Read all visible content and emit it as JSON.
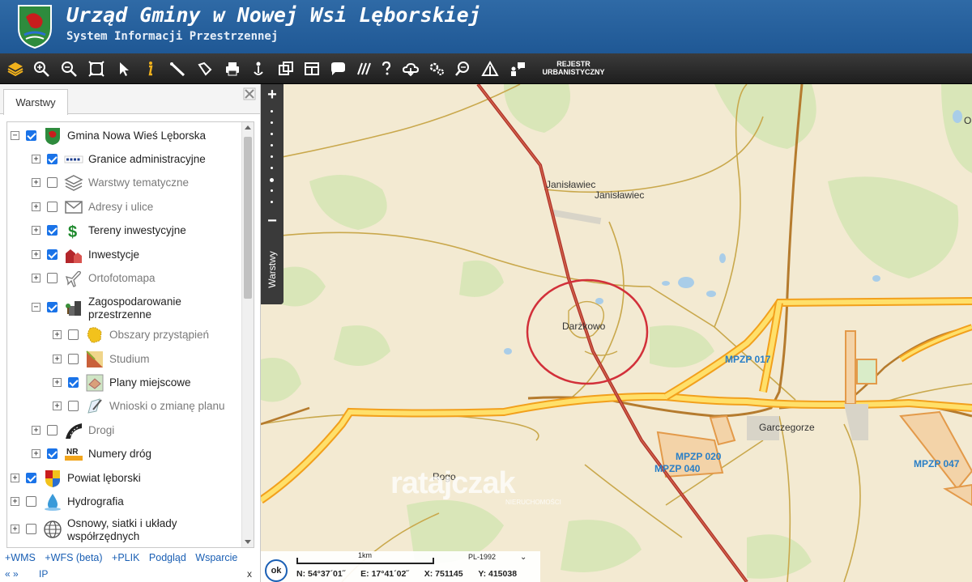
{
  "header": {
    "title": "Urząd Gminy w Nowej Wsi Lęborskiej",
    "subtitle": "System Informacji Przestrzennej"
  },
  "toolbar": {
    "buttons": [
      "layers-icon",
      "zoom-in-icon",
      "zoom-out-icon",
      "zoom-extent-icon",
      "select-icon",
      "info-icon",
      "measure-distance-icon",
      "measure-area-icon",
      "print-icon",
      "location-icon",
      "copy-icon",
      "layout-icon",
      "comment-icon",
      "hatch-icon",
      "help-icon",
      "cloud-icon",
      "settings-icon",
      "search-icon",
      "warning-icon",
      "user-chat-icon"
    ],
    "rejestr_line1": "REJESTR",
    "rejestr_line2": "URBANISTYCZNY"
  },
  "panel": {
    "tab_label": "Warstwy",
    "tree": [
      {
        "label": "Gmina Nowa Wieś Lęborska",
        "checked": true,
        "icon": "crest-icon"
      },
      {
        "label": "Granice administracyjne",
        "checked": true,
        "icon": "boundary-icon"
      },
      {
        "label": "Warstwy tematyczne",
        "checked": false,
        "icon": "layers-stack-icon"
      },
      {
        "label": "Adresy i ulice",
        "checked": false,
        "icon": "envelope-icon"
      },
      {
        "label": "Tereny inwestycyjne",
        "checked": true,
        "icon": "dollar-icon"
      },
      {
        "label": "Inwestycje",
        "checked": true,
        "icon": "buildings-icon"
      },
      {
        "label": "Ortofotomapa",
        "checked": false,
        "icon": "plane-icon"
      },
      {
        "label": "Zagospodarowanie przestrzenne",
        "checked": true,
        "icon": "city-icon"
      },
      {
        "label": "Obszary przystąpień",
        "checked": false,
        "icon": "area-icon"
      },
      {
        "label": "Studium",
        "checked": false,
        "icon": "studium-icon"
      },
      {
        "label": "Plany miejscowe",
        "checked": true,
        "icon": "plan-icon"
      },
      {
        "label": "Wnioski o zmianę planu",
        "checked": false,
        "icon": "pen-icon"
      },
      {
        "label": "Drogi",
        "checked": false,
        "icon": "road-icon"
      },
      {
        "label": "Numery dróg",
        "checked": true,
        "icon": "nr-icon"
      },
      {
        "label": "Powiat lęborski",
        "checked": true,
        "icon": "crest-icon"
      },
      {
        "label": "Hydrografia",
        "checked": false,
        "icon": "drop-icon"
      },
      {
        "label": "Osnowy, siatki i układy współrzędnych",
        "checked": false,
        "icon": "globe-icon"
      }
    ],
    "links": [
      "+WMS",
      "+WFS (beta)",
      "+PLIK",
      "Podgląd",
      "Wsparcie"
    ],
    "footer_left": "«  »",
    "footer_ip": "IP",
    "footer_close": "x"
  },
  "map": {
    "places": [
      "Janisławiec",
      "Janisławiec",
      "Darżkowo",
      "Garczegorze",
      "Rogo"
    ],
    "mpzp": [
      "MPZP 017",
      "MPZP 020",
      "MPZP 040",
      "MPZP 047"
    ],
    "edge_letter": "O",
    "watermark": "ratajczak",
    "watermark_sub": "NIERUCHOMOŚCI",
    "layers_tab_label": "Warstwy"
  },
  "status": {
    "ok_label": "ok",
    "scale_label": "1km",
    "crs": "PL-1992",
    "lat": "N: 54°37´01˝",
    "lon": "E: 17°41´02˝",
    "x": "X: 751145",
    "y": "Y: 415038"
  }
}
